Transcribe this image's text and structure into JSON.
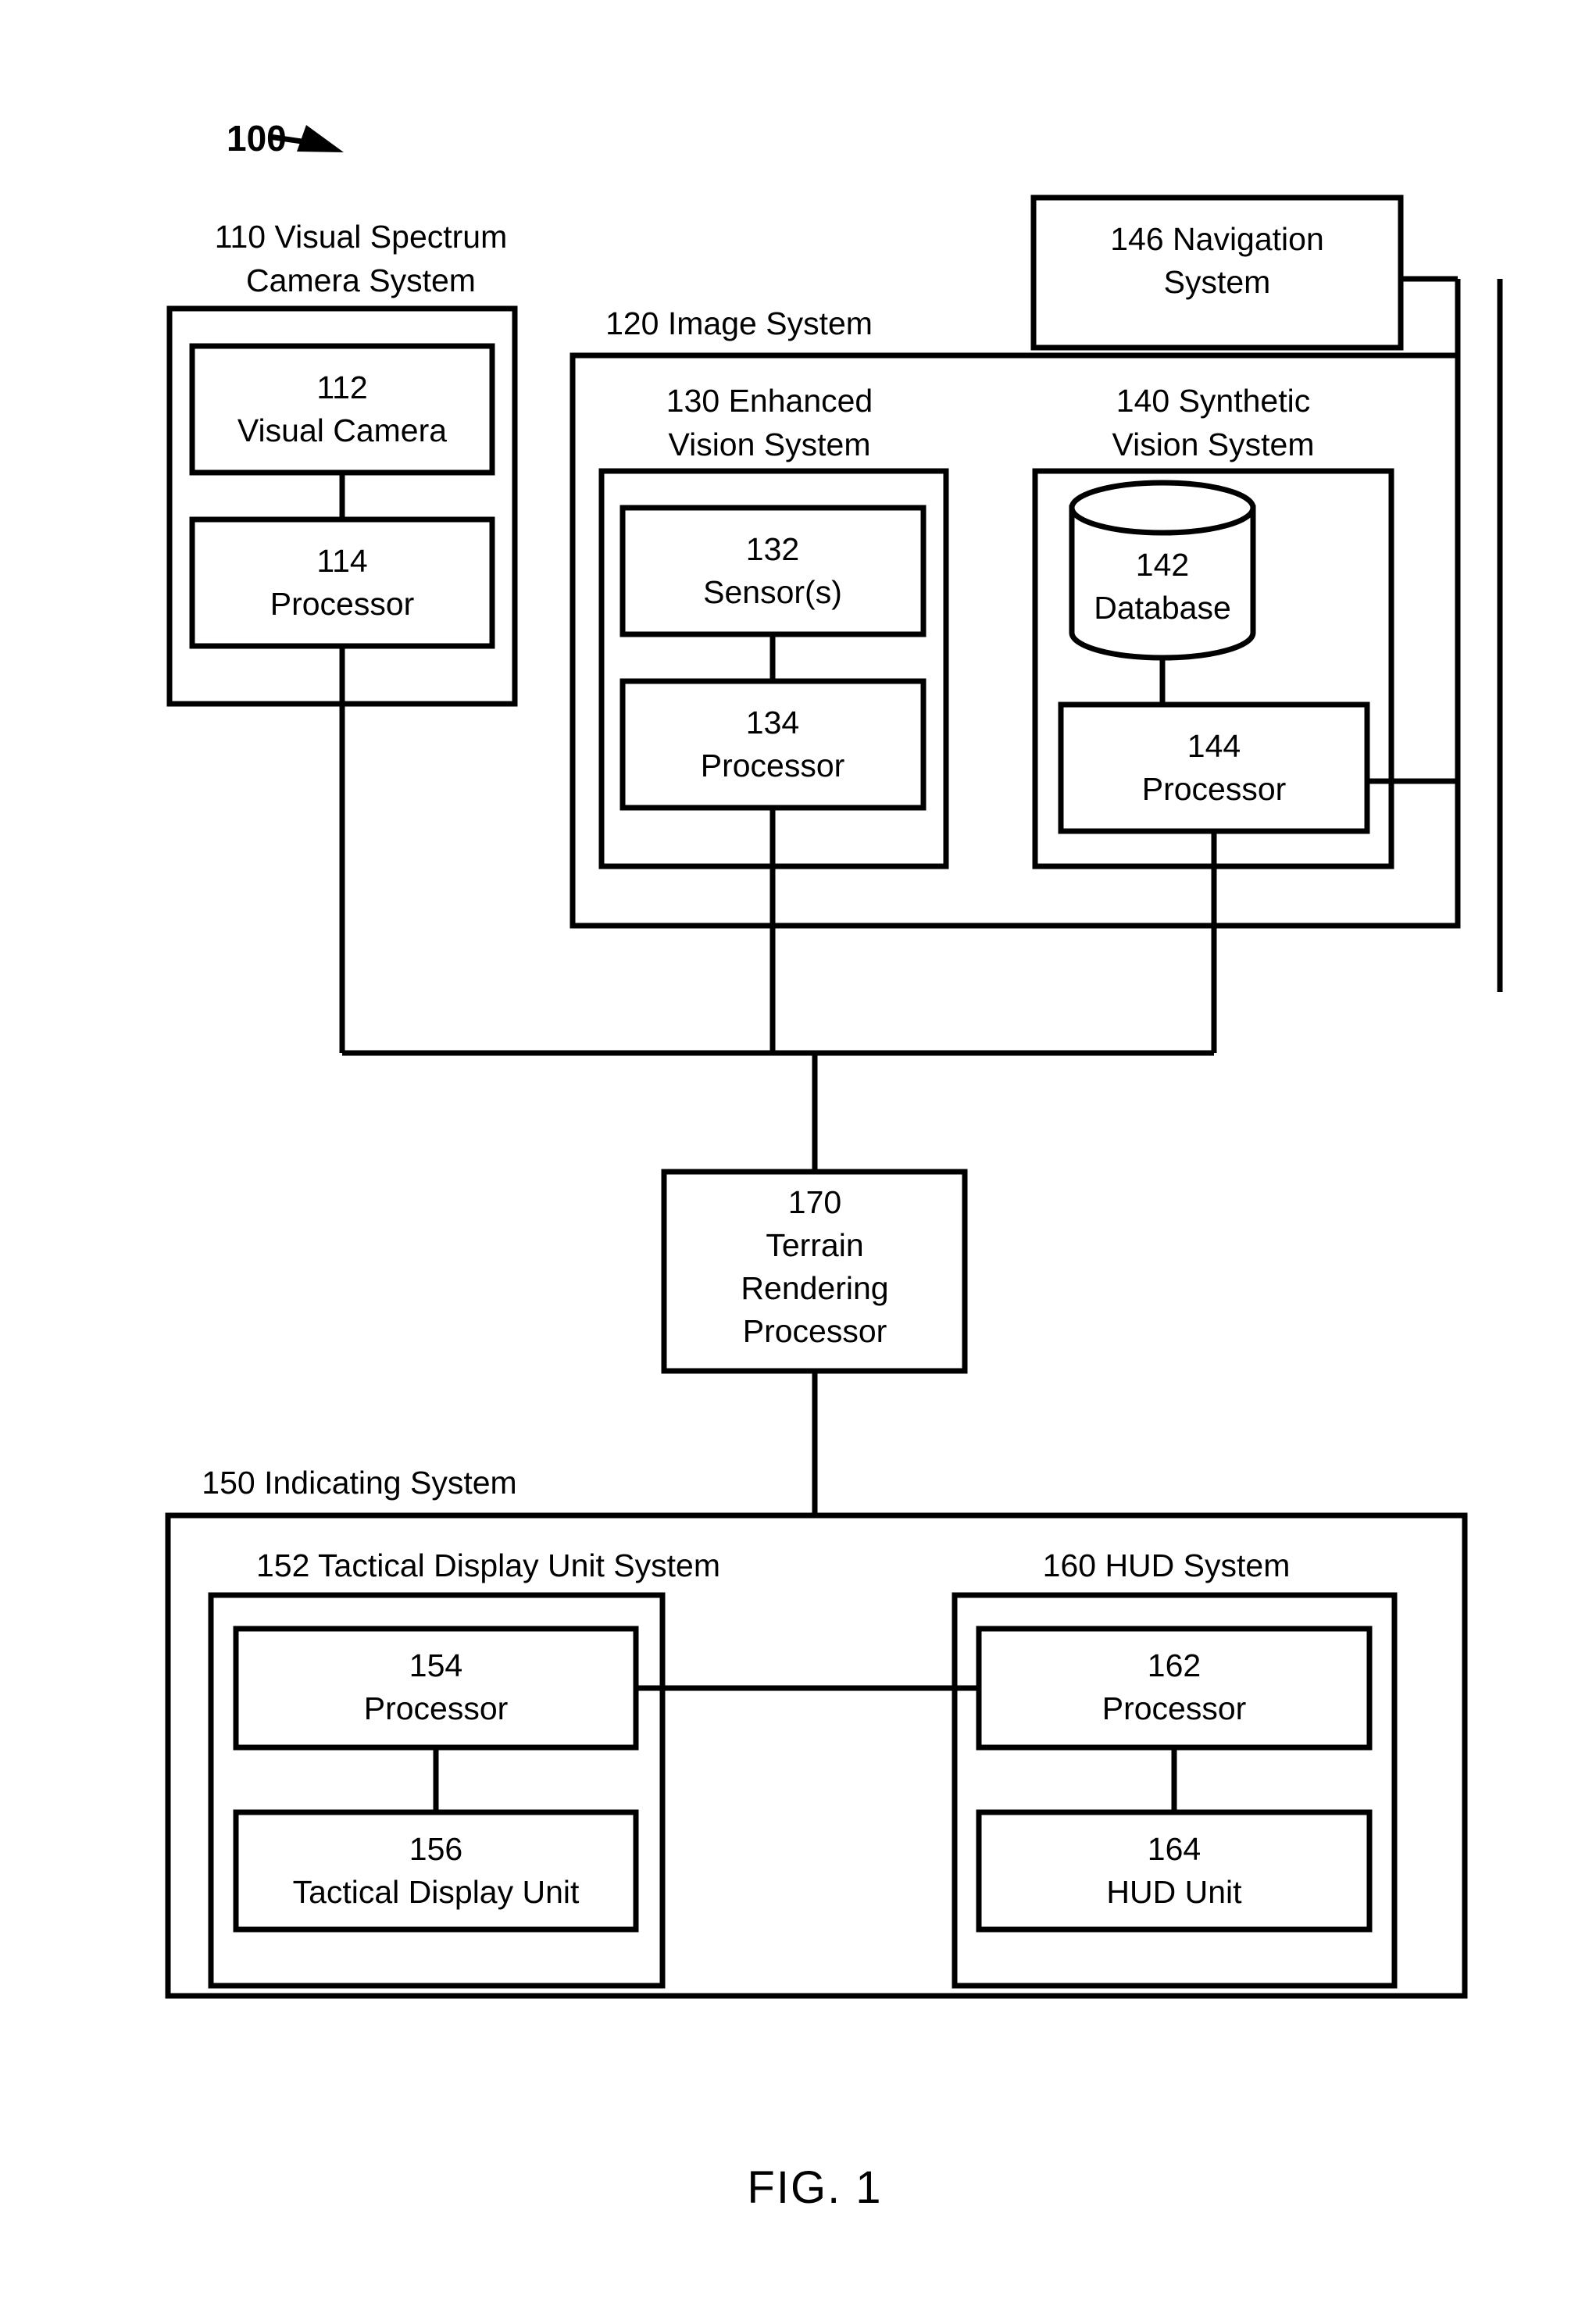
{
  "figure": {
    "ref_numeral": "100",
    "caption": "FIG. 1",
    "arrow_icon": "ref-arrow-icon"
  },
  "systems": {
    "camera_system": {
      "label_line1": "110 Visual Spectrum",
      "label_line2": "Camera System",
      "children": [
        {
          "ref": "112",
          "name": "Visual Camera"
        },
        {
          "ref": "114",
          "name": "Processor"
        }
      ]
    },
    "image_system": {
      "label": "120 Image System",
      "enhanced_vision": {
        "label_line1": "130  Enhanced",
        "label_line2": "Vision System",
        "children": [
          {
            "ref": "132",
            "name": "Sensor(s)"
          },
          {
            "ref": "134",
            "name": "Processor"
          }
        ]
      },
      "synthetic_vision": {
        "label_line1": "140  Synthetic",
        "label_line2": "Vision System",
        "database": {
          "ref": "142",
          "name": "Database"
        },
        "processor": {
          "ref": "144",
          "name": "Processor"
        }
      }
    },
    "navigation_system": {
      "label_line1": "146 Navigation",
      "label_line2": "System"
    },
    "terrain_rendering_processor": {
      "ref": "170",
      "name_line1": "Terrain",
      "name_line2": "Rendering",
      "name_line3": "Processor"
    },
    "indicating_system": {
      "label": "150 Indicating System",
      "tactical_display_unit_system": {
        "label": "152 Tactical Display Unit System",
        "children": [
          {
            "ref": "154",
            "name": "Processor"
          },
          {
            "ref": "156",
            "name": "Tactical Display Unit"
          }
        ]
      },
      "hud_system": {
        "label": "160 HUD System",
        "children": [
          {
            "ref": "162",
            "name": "Processor"
          },
          {
            "ref": "164",
            "name": "HUD Unit"
          }
        ]
      }
    }
  },
  "colors": {
    "line": "#000000",
    "fill": "#ffffff"
  }
}
